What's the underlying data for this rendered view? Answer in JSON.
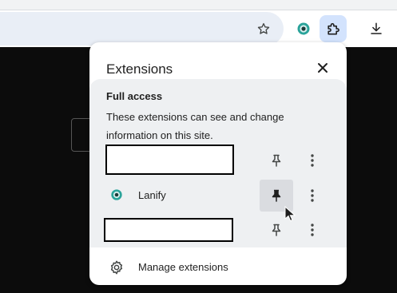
{
  "browser": {
    "toolbar_icons": [
      "star-icon",
      "extension-lanify-icon",
      "extensions-puzzle-icon",
      "download-icon"
    ]
  },
  "popup": {
    "title": "Extensions",
    "section": {
      "heading": "Full access",
      "description": "These extensions can see and change information on this site."
    },
    "extensions": [
      {
        "name": "",
        "pinned": false,
        "redacted": true
      },
      {
        "name": "Lanify",
        "pinned": true,
        "redacted": false
      },
      {
        "name": "",
        "pinned": false,
        "redacted": true
      }
    ],
    "manage_label": "Manage extensions"
  },
  "colors": {
    "accent_teal": "#2aa39a",
    "page_background": "#0c0c0c",
    "section_background": "#eef0f2"
  }
}
